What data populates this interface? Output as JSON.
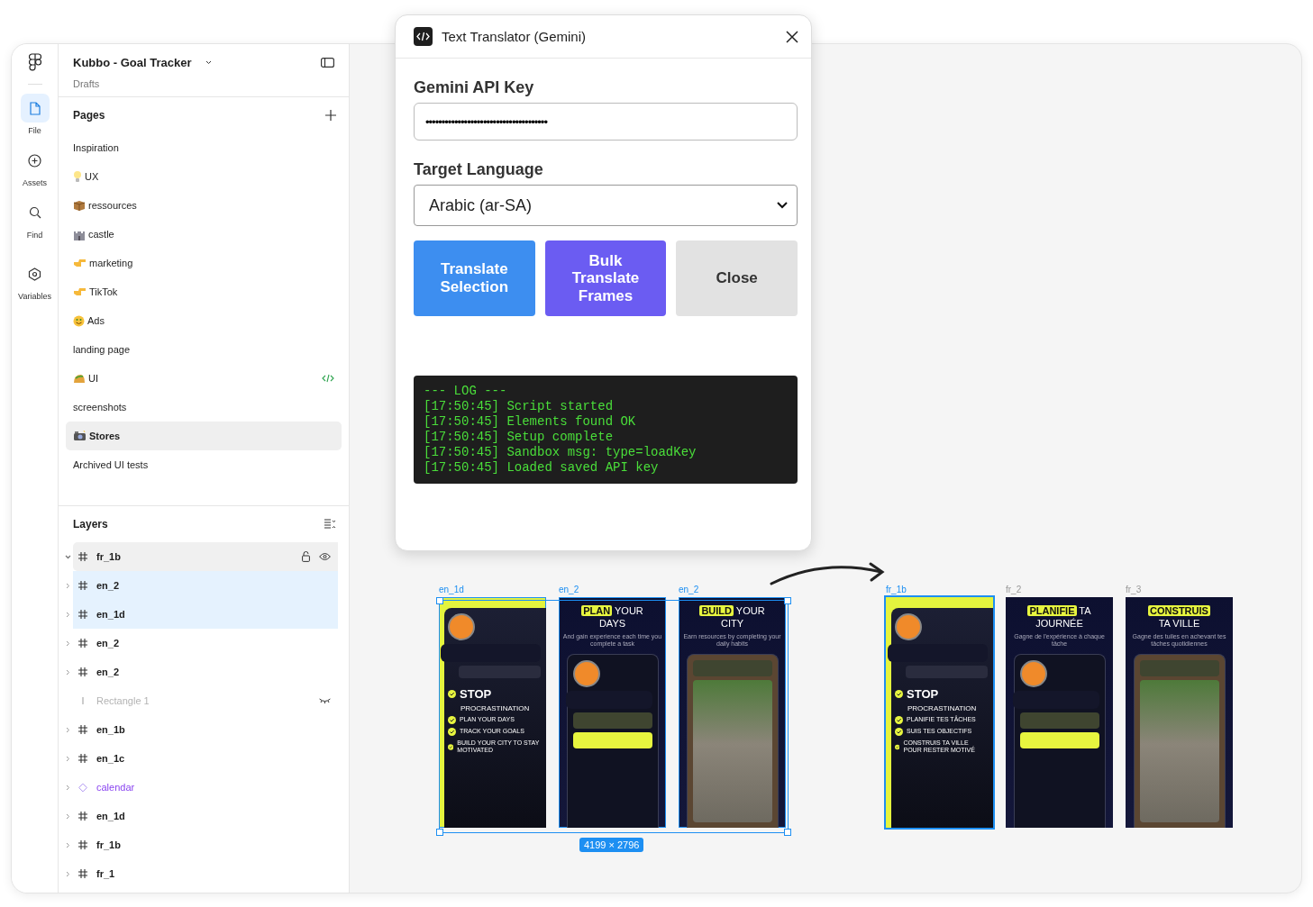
{
  "rail": {
    "items": [
      {
        "label": "File",
        "selected": true
      },
      {
        "label": "Assets",
        "selected": false
      },
      {
        "label": "Find",
        "selected": false
      },
      {
        "label": "Variables",
        "selected": false
      }
    ]
  },
  "file": {
    "title": "Kubbo - Goal Tracker",
    "location": "Drafts"
  },
  "pages": {
    "title": "Pages",
    "items": [
      {
        "label": "Inspiration",
        "selected": false,
        "plugin_running": false
      },
      {
        "label": "UX",
        "selected": false,
        "plugin_running": false
      },
      {
        "label": "ressources",
        "selected": false,
        "plugin_running": false
      },
      {
        "label": "castle",
        "selected": false,
        "plugin_running": false
      },
      {
        "label": "marketing",
        "selected": false,
        "plugin_running": false
      },
      {
        "label": "TikTok",
        "selected": false,
        "plugin_running": false
      },
      {
        "label": "Ads",
        "selected": false,
        "plugin_running": false
      },
      {
        "label": "landing page",
        "selected": false,
        "plugin_running": false
      },
      {
        "label": "UI",
        "selected": false,
        "plugin_running": true
      },
      {
        "label": "screenshots",
        "selected": false,
        "plugin_running": false
      },
      {
        "label": "Stores",
        "selected": true,
        "plugin_running": false
      },
      {
        "label": "Archived UI tests",
        "selected": false,
        "plugin_running": false
      }
    ]
  },
  "layers": {
    "title": "Layers",
    "items": [
      {
        "name": "fr_1b",
        "kind": "frame",
        "selected": false,
        "hovered": true,
        "expanded": true,
        "hidden": false
      },
      {
        "name": "en_2",
        "kind": "frame",
        "selected": true,
        "hovered": false,
        "expanded": false,
        "hidden": false
      },
      {
        "name": "en_1d",
        "kind": "frame",
        "selected": true,
        "hovered": false,
        "expanded": false,
        "hidden": false
      },
      {
        "name": "en_2",
        "kind": "frame",
        "selected": false,
        "hovered": false,
        "expanded": false,
        "hidden": false
      },
      {
        "name": "en_2",
        "kind": "frame",
        "selected": false,
        "hovered": false,
        "expanded": false,
        "hidden": false
      },
      {
        "name": "Rectangle 1",
        "kind": "rectangle",
        "selected": false,
        "hovered": false,
        "expanded": false,
        "hidden": true
      },
      {
        "name": "en_1b",
        "kind": "frame",
        "selected": false,
        "hovered": false,
        "expanded": false,
        "hidden": false
      },
      {
        "name": "en_1c",
        "kind": "frame",
        "selected": false,
        "hovered": false,
        "expanded": false,
        "hidden": false
      },
      {
        "name": "calendar",
        "kind": "component",
        "selected": false,
        "hovered": false,
        "expanded": false,
        "hidden": false
      },
      {
        "name": "en_1d",
        "kind": "frame",
        "selected": false,
        "hovered": false,
        "expanded": false,
        "hidden": false
      },
      {
        "name": "fr_1b",
        "kind": "frame",
        "selected": false,
        "hovered": false,
        "expanded": false,
        "hidden": false
      },
      {
        "name": "fr_1",
        "kind": "frame",
        "selected": false,
        "hovered": false,
        "expanded": false,
        "hidden": false
      }
    ]
  },
  "plugin": {
    "title": "Text Translator (Gemini)",
    "api_key_label": "Gemini API Key",
    "api_key_value": "••••••••••••••••••••••••••••••••••••••",
    "language_label": "Target Language",
    "language_value": "Arabic (ar-SA)",
    "buttons": [
      {
        "label": "Translate Selection",
        "kind": "primary"
      },
      {
        "label": "Bulk Translate Frames",
        "kind": "secondary"
      },
      {
        "label": "Close",
        "kind": "neutral"
      }
    ],
    "log": [
      "--- LOG ---",
      "[17:50:45] Script started",
      "[17:50:45] Elements found OK",
      "[17:50:45] Setup complete",
      "[17:50:45] Sandbox msg: type=loadKey",
      "[17:50:45] Loaded saved API key"
    ]
  },
  "canvas": {
    "selection_size": "4199 × 2796",
    "groups": [
      {
        "frames": [
          {
            "name": "en_1d",
            "selected": true,
            "hovered": false,
            "kind": "checklist",
            "title": "STOP",
            "subtitle": "PROCRASTINATION",
            "items": [
              "PLAN YOUR DAYS",
              "TRACK YOUR GOALS",
              "BUILD YOUR CITY TO STAY MOTIVATED"
            ]
          },
          {
            "name": "en_2",
            "selected": true,
            "hovered": false,
            "kind": "promo",
            "highlight": "PLAN",
            "headline_rest": "YOUR",
            "headline_line2": "DAYS",
            "subtitle": "And gain experience each time you complete a task"
          },
          {
            "name": "en_2",
            "selected": true,
            "hovered": false,
            "kind": "promo",
            "highlight": "BUILD",
            "headline_rest": "YOUR",
            "headline_line2": "CITY",
            "subtitle": "Earn resources by completing your daily habits"
          }
        ]
      },
      {
        "frames": [
          {
            "name": "fr_1b",
            "selected": false,
            "hovered": true,
            "kind": "checklist",
            "title": "STOP",
            "subtitle": "PROCRASTINATION",
            "items": [
              "PLANIFIE TES TÂCHES",
              "SUIS TES OBJECTIFS",
              "CONSTRUIS TA VILLE POUR RESTER MOTIVÉ"
            ]
          },
          {
            "name": "fr_2",
            "selected": false,
            "hovered": false,
            "kind": "promo",
            "highlight": "PLANIFIE",
            "headline_rest": "TA",
            "headline_line2": "JOURNÉE",
            "subtitle": "Gagne de l'expérience à chaque tâche"
          },
          {
            "name": "fr_3",
            "selected": false,
            "hovered": false,
            "kind": "promo",
            "highlight": "CONSTRUIS",
            "headline_line2": "TA VILLE",
            "subtitle": "Gagne des tuiles en achevant tes tâches quotidiennes"
          }
        ]
      }
    ]
  }
}
